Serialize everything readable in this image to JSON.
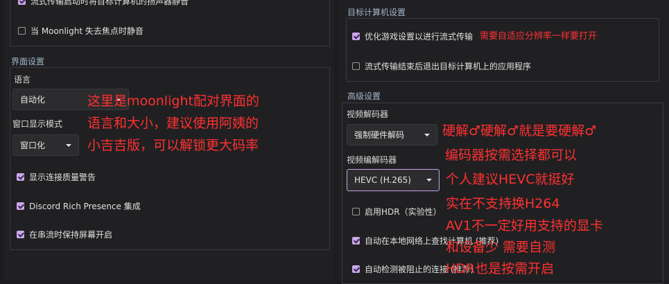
{
  "left": {
    "top_cut_text": "流式传输启动时将目标计算机的扬声器静音",
    "mute_unfocused": "当 Moonlight 失去焦点时静音",
    "ui_section_title": "界面设置",
    "language_label": "语言",
    "language_value": "自动化",
    "window_mode_label": "窗口显示模式",
    "window_mode_value": "窗口化",
    "quality_warning": "显示连接质量警告",
    "discord_rp": "Discord Rich Presence 集成",
    "keep_awake": "在串流时保持屏幕开启"
  },
  "right": {
    "host_section_title": "目标计算机设置",
    "optimize_game": "优化游戏设置以进行流式传输",
    "quit_app": "流式传输结束后退出目标计算机上的应用程序",
    "adv_section_title": "高级设置",
    "video_decoder_label": "视频解码器",
    "video_decoder_value": "强制硬件解码",
    "video_codec_label": "视频编解码器",
    "video_codec_value": "HEVC (H.265)",
    "enable_hdr": "启用HDR（实验性）",
    "auto_find": "自动在本地网络上查找计算机 (推荐)",
    "auto_detect": "自动检测被阻止的连接 (推荐)"
  },
  "annotations": {
    "a1": "需要自适应分辨率一样要打开",
    "a2_l1": "这里是moonlight配对界面的",
    "a2_l2": "语言和大小，建议使用阿姨的",
    "a2_l3": "小吉吉版，可以解锁更大码率",
    "a3_l1": "硬解♂硬解♂就是要硬解♂",
    "a3_l2": "编码器按需选择都可以",
    "a3_l3": "个人建议HEVC就挺好",
    "a3_l4": "实在不支持换H264",
    "a3_l5": "AV1不一定好用支持的显卡",
    "a3_l6": "和设备少 需要自测",
    "a3_l7": "HDR也是按需开启"
  },
  "colors": {
    "accent": "#c9a7e8",
    "annotation": "#ff3131",
    "background": "#1c1c1e"
  }
}
